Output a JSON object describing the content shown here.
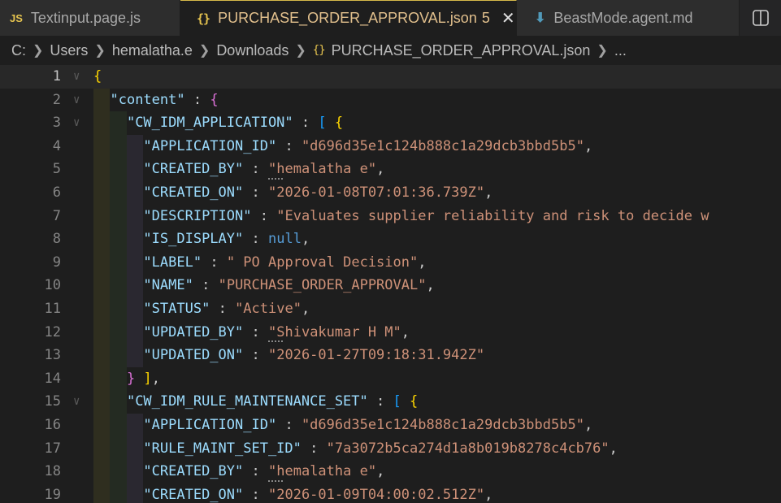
{
  "tabs": [
    {
      "label": "Textinput.page.js",
      "icon": "js-icon",
      "icon_text": "JS",
      "active": false
    },
    {
      "label": "PURCHASE_ORDER_APPROVAL.json",
      "icon": "json-icon",
      "icon_text": "{}",
      "badge": "5",
      "active": true
    },
    {
      "label": "BeastMode.agent.md",
      "icon": "markdown-down-arrow-icon",
      "icon_text": "⬇",
      "active": false
    }
  ],
  "tab_close_glyph": "✕",
  "split_editor_icon": "split-editor-icon",
  "breadcrumb": {
    "segments": [
      "C:",
      "Users",
      "hemalatha.e",
      "Downloads"
    ],
    "file_icon_text": "{}",
    "file": "PURCHASE_ORDER_APPROVAL.json",
    "ellipsis": "..."
  },
  "colors": {
    "background": "#1e1e1e",
    "key": "#9cdcfe",
    "string": "#ce9178",
    "null": "#569cd6",
    "bracket_level_1": "#ffd700",
    "bracket_level_2": "#da70d6",
    "bracket_level_3": "#179fff",
    "active_tab_text": "#e2c08d"
  },
  "editor": {
    "lines": [
      {
        "n": "1",
        "text": "{"
      },
      {
        "n": "2",
        "text": "  \"content\" : {"
      },
      {
        "n": "3",
        "text": "    \"CW_IDM_APPLICATION\" : [ {"
      },
      {
        "n": "4",
        "text": "      \"APPLICATION_ID\" : \"d696d35e1c124b888c1a29dcb3bbd5b5\","
      },
      {
        "n": "5",
        "text": "      \"CREATED_BY\" : \"hemalatha e\","
      },
      {
        "n": "6",
        "text": "      \"CREATED_ON\" : \"2026-01-08T07:01:36.739Z\","
      },
      {
        "n": "7",
        "text": "      \"DESCRIPTION\" : \"Evaluates supplier reliability and risk to decide w"
      },
      {
        "n": "8",
        "text": "      \"IS_DISPLAY\" : null,"
      },
      {
        "n": "9",
        "text": "      \"LABEL\" : \" PO Approval Decision\","
      },
      {
        "n": "10",
        "text": "      \"NAME\" : \"PURCHASE_ORDER_APPROVAL\","
      },
      {
        "n": "11",
        "text": "      \"STATUS\" : \"Active\","
      },
      {
        "n": "12",
        "text": "      \"UPDATED_BY\" : \"Shivakumar H M\","
      },
      {
        "n": "13",
        "text": "      \"UPDATED_ON\" : \"2026-01-27T09:18:31.942Z\""
      },
      {
        "n": "14",
        "text": "    } ],"
      },
      {
        "n": "15",
        "text": "    \"CW_IDM_RULE_MAINTENANCE_SET\" : [ {"
      },
      {
        "n": "16",
        "text": "      \"APPLICATION_ID\" : \"d696d35e1c124b888c1a29dcb3bbd5b5\","
      },
      {
        "n": "17",
        "text": "      \"RULE_MAINT_SET_ID\" : \"7a3072b5ca274d1a8b019b8278c4cb76\","
      },
      {
        "n": "18",
        "text": "      \"CREATED_BY\" : \"hemalatha e\","
      },
      {
        "n": "19",
        "text": "      \"CREATED_ON\" : \"2026-01-09T04:00:02.512Z\","
      }
    ]
  }
}
